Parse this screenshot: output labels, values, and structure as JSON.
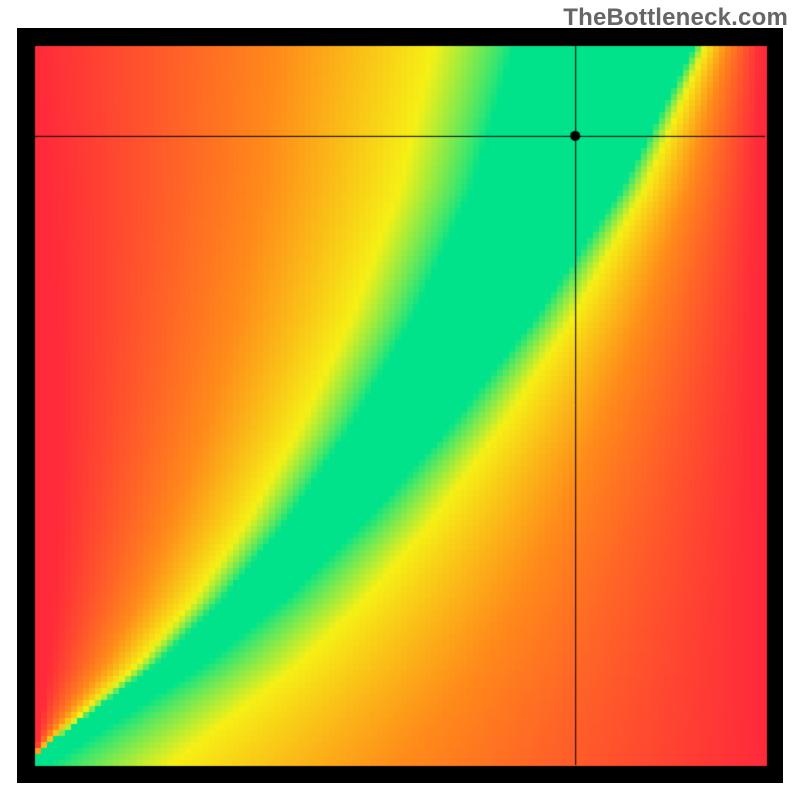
{
  "watermark": "TheBottleneck.com",
  "chart_data": {
    "type": "heatmap",
    "title": "",
    "xlabel": "",
    "ylabel": "",
    "x_range": [
      0,
      1
    ],
    "y_range": [
      0,
      1
    ],
    "crosshair": {
      "x": 0.74,
      "y": 0.875
    },
    "optimal_ridge": {
      "description": "green diagonal ridge where no bottleneck occurs; curve starts near (0,0), sweeps convex to near (1,1), slightly right of diagonal",
      "points": [
        [
          0.0,
          0.0
        ],
        [
          0.1,
          0.07
        ],
        [
          0.2,
          0.14
        ],
        [
          0.3,
          0.23
        ],
        [
          0.4,
          0.34
        ],
        [
          0.5,
          0.47
        ],
        [
          0.6,
          0.62
        ],
        [
          0.7,
          0.8
        ],
        [
          0.78,
          1.0
        ]
      ],
      "ridge_width_frac": 0.055
    },
    "color_stops": [
      {
        "offset": 0.0,
        "color": "#00e38a"
      },
      {
        "offset": 0.22,
        "color": "#f6f015"
      },
      {
        "offset": 0.55,
        "color": "#ff8a1a"
      },
      {
        "offset": 1.0,
        "color": "#ff2a3a"
      }
    ],
    "border_color": "#000000",
    "marker": {
      "x": 0.74,
      "y": 0.875,
      "r": 5,
      "color": "#000000"
    }
  }
}
